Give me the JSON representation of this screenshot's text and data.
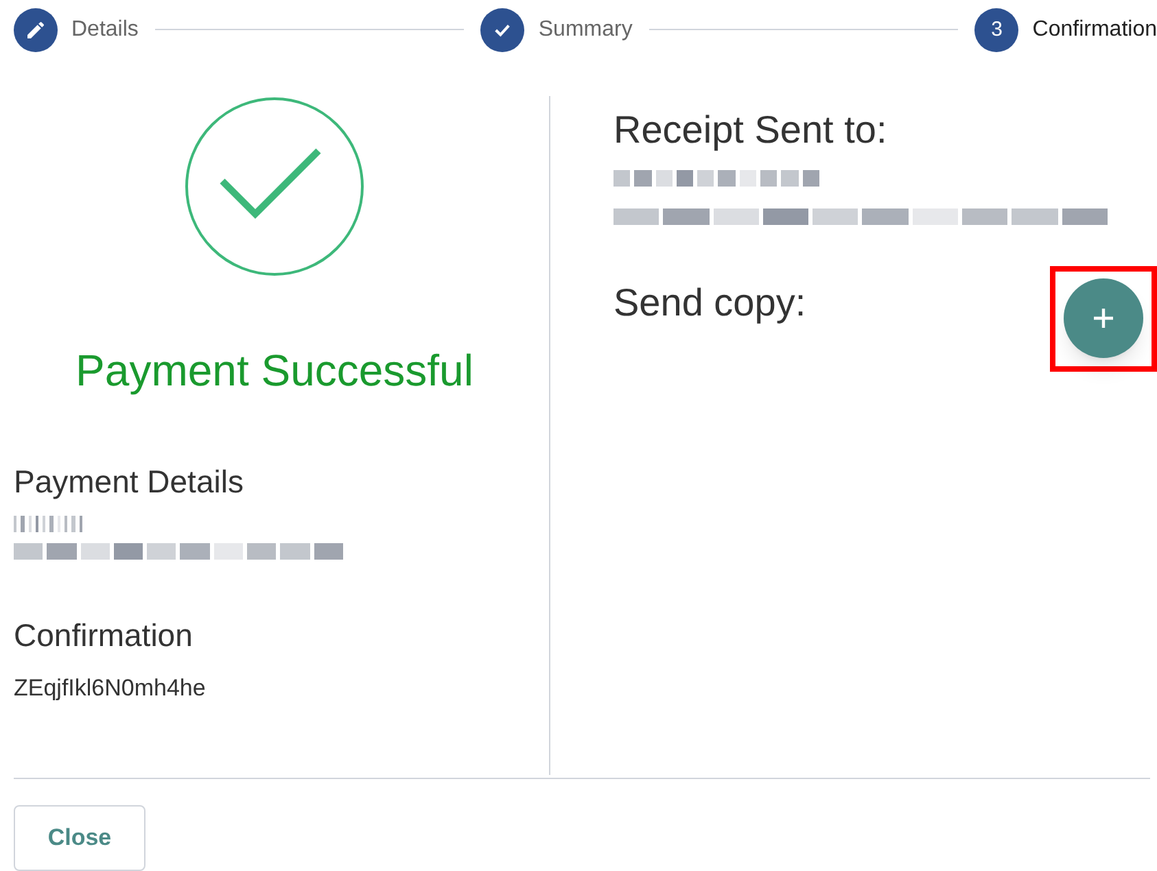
{
  "stepper": [
    {
      "label": "Details",
      "kind": "edit"
    },
    {
      "label": "Summary",
      "kind": "done"
    },
    {
      "label": "Confirmation",
      "kind": "active",
      "number": "3"
    }
  ],
  "left": {
    "status_title": "Payment Successful",
    "sections": [
      {
        "heading": "Payment Details",
        "redacted": true
      },
      {
        "heading": "Confirmation",
        "value": "ZEqjfIkl6N0mh4he"
      }
    ]
  },
  "right": {
    "receipt_heading": "Receipt Sent to:",
    "redacted": true,
    "send_copy_label": "Send copy:",
    "add_button": {
      "highlighted": true
    }
  },
  "footer": {
    "close_button": "Close"
  }
}
